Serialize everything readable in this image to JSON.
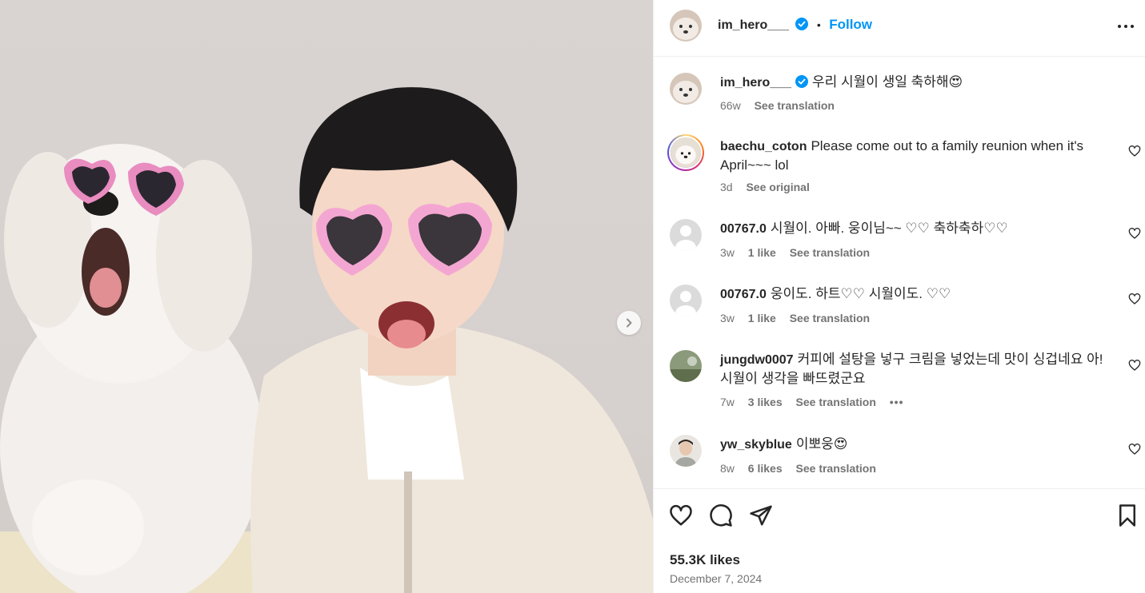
{
  "post": {
    "author": "im_hero___",
    "follow_label": "Follow",
    "separator": "•",
    "caption": "우리 시월이 생일 축하해😍",
    "caption_age": "66w",
    "see_translation": "See translation",
    "likes": "55.3K likes",
    "date": "December 7, 2024"
  },
  "comments": [
    {
      "user": "baechu_coton",
      "text": "Please come out to a family reunion when it's April~~~ lol",
      "age": "3d",
      "likes": "",
      "action": "See original"
    },
    {
      "user": "00767.0",
      "text": "시월이. 아빠. 웅이님~~ ♡♡ 축하축하♡♡",
      "age": "3w",
      "likes": "1 like",
      "action": "See translation"
    },
    {
      "user": "00767.0",
      "text": "웅이도. 하트♡♡ 시월이도. ♡♡",
      "age": "3w",
      "likes": "1 like",
      "action": "See translation"
    },
    {
      "user": "jungdw0007",
      "text": "커피에 설탕을 넣구 크림을 넣었는데 맛이 싱겁네요 아! 시월이 생각을 빠뜨렸군요",
      "age": "7w",
      "likes": "3 likes",
      "action": "See translation",
      "more": "•••"
    },
    {
      "user": "yw_skyblue",
      "text": "이뽀웅😍",
      "age": "8w",
      "likes": "6 likes",
      "action": "See translation"
    }
  ],
  "icons": {
    "verified": "verified-badge-icon",
    "more": "more-options-icon",
    "like": "heart-icon",
    "comment": "comment-icon",
    "share": "share-icon",
    "save": "bookmark-icon",
    "next": "chevron-right-icon"
  },
  "colors": {
    "accent": "#0095f6",
    "text": "#262626",
    "muted": "#737373",
    "border": "#efefef"
  }
}
